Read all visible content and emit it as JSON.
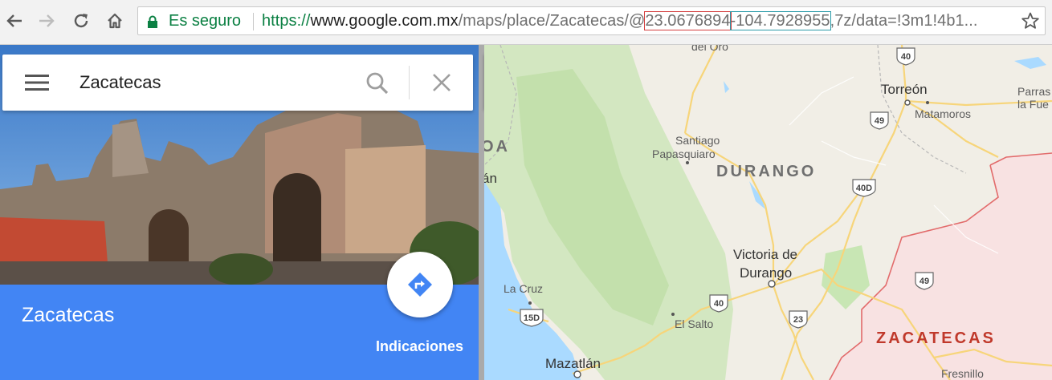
{
  "browser": {
    "secure_label": "Es seguro",
    "url_scheme": "https://",
    "url_host": "www.google.com.mx",
    "url_path": "/maps/place/Zacatecas/@",
    "url_lat": "23.0676894",
    "url_lng": "-104.7928955",
    "url_tail": ",7z/data=!3m1!4b1..."
  },
  "search": {
    "value": "Zacatecas"
  },
  "place": {
    "name": "Zacatecas",
    "directions_label": "Indicaciones"
  },
  "map": {
    "labels": {
      "del_oro": "del Oro",
      "oa": "OA",
      "an": "án",
      "santiago_papasquiaro_1": "Santiago",
      "santiago_papasquiaro_2": "Papasquiaro",
      "durango_state": "DURANGO",
      "torreon": "Torreón",
      "matamoros": "Matamoros",
      "parras_1": "Parras",
      "parras_2": "la Fue",
      "victoria_1": "Victoria de",
      "victoria_2": "Durango",
      "la_cruz": "La Cruz",
      "el_salto": "El Salto",
      "mazatlan": "Mazatlán",
      "zacatecas_state": "ZACATECAS",
      "fresnillo": "Fresnillo"
    },
    "shields": {
      "s40_top": "40",
      "s49_top": "49",
      "s40d": "40D",
      "s49_mid": "49",
      "s40_low": "40",
      "s23": "23",
      "s15d": "15D"
    },
    "colors": {
      "land": "#f1eee6",
      "water": "#aadaff",
      "park": "#c8e6b4",
      "highway": "#f7d57a",
      "zacatecas_region": "#f8e2e2",
      "border": "#e26b6b"
    }
  }
}
